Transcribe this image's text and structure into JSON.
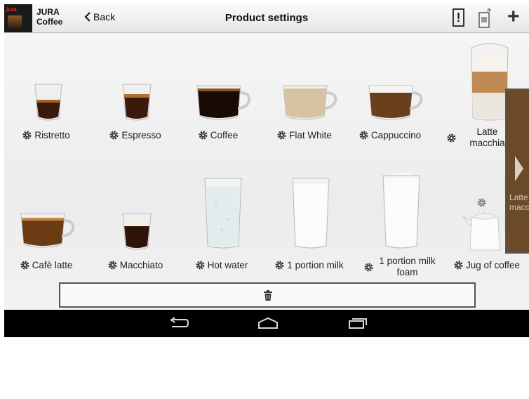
{
  "header": {
    "brand_line1": "JURA",
    "brand_line2": "Coffee",
    "back_label": "Back",
    "title": "Product settings",
    "alert_label": "!"
  },
  "products_row1": [
    {
      "name": "Ristretto"
    },
    {
      "name": "Espresso"
    },
    {
      "name": "Coffee"
    },
    {
      "name": "Flat White"
    },
    {
      "name": "Cappuccino"
    },
    {
      "name": "Latte macchiato",
      "line1": "Latte",
      "line2": "macchia"
    }
  ],
  "products_row2": [
    {
      "name": "Cafè latte"
    },
    {
      "name": "Macchiato"
    },
    {
      "name": "Hot water"
    },
    {
      "name": "1 portion milk"
    },
    {
      "name": "1 portion milk foam",
      "line1": "1 portion milk",
      "line2": "foam"
    },
    {
      "name": "Jug of coffee"
    }
  ],
  "side_panel": {
    "line1": "Latte",
    "line2": "macch"
  },
  "icons": {
    "back": "chevron-left-icon",
    "alert": "exclamation-icon",
    "machine": "coffee-machine-icon",
    "add": "plus-icon",
    "settings": "gear-icon",
    "trash": "trash-icon",
    "nav_back": "back-icon",
    "nav_home": "home-icon",
    "nav_recents": "recents-icon"
  },
  "colors": {
    "accent": "#6b4a2a",
    "bar": "#000000"
  }
}
